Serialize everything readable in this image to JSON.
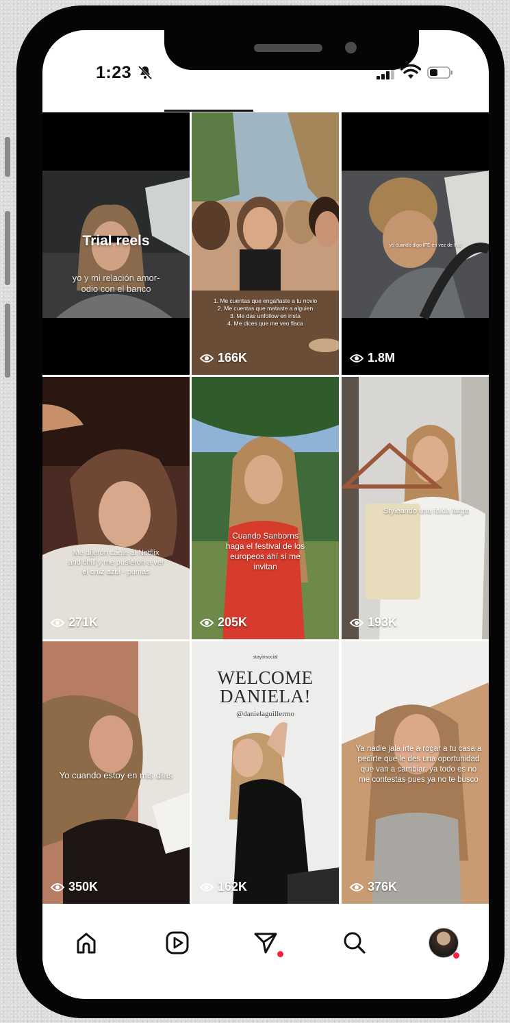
{
  "status_bar": {
    "time": "1:23"
  },
  "grid": {
    "items": [
      {
        "label": "Trial reels",
        "caption": "yo y mi relación amor-odio con el banco",
        "views": ""
      },
      {
        "caption": "1. Me cuentas que engañaste a tu novio\n2. Me cuentas que mataste a alguien\n3. Me das unfollow en insta\n4. Me dices que me veo flaca",
        "views": "166K"
      },
      {
        "caption": "yo cuando digo IFE en vez de INE",
        "views": "1.8M"
      },
      {
        "caption": "Me dijeron cáele al Netflix and chill y me pusieron a ver el cruz azul - pumas",
        "views": "271K"
      },
      {
        "caption": "Cuando Sanborns haga el festival de los europeos ahí sí me invitan",
        "views": "205K"
      },
      {
        "caption": "Styleando una falda larga",
        "views": "193K"
      },
      {
        "caption": "Yo cuando estoy en mis días",
        "views": "350K"
      },
      {
        "brand": "stayinsocial",
        "title": "WELCOME DANIELA!",
        "handle": "@danielaguillermo",
        "views": "162K"
      },
      {
        "caption": "Ya nadie jala irte a rogar a tu casa a pedirte que le des una oportunidad que van a cambiar, ya todo es no me contestas pues ya no te busco",
        "views": "376K"
      }
    ]
  },
  "bottom_nav": {
    "items": [
      "home-icon",
      "reels-icon",
      "direct-icon",
      "search-icon",
      "profile-avatar"
    ],
    "notification_color": "#ff1f3d"
  }
}
